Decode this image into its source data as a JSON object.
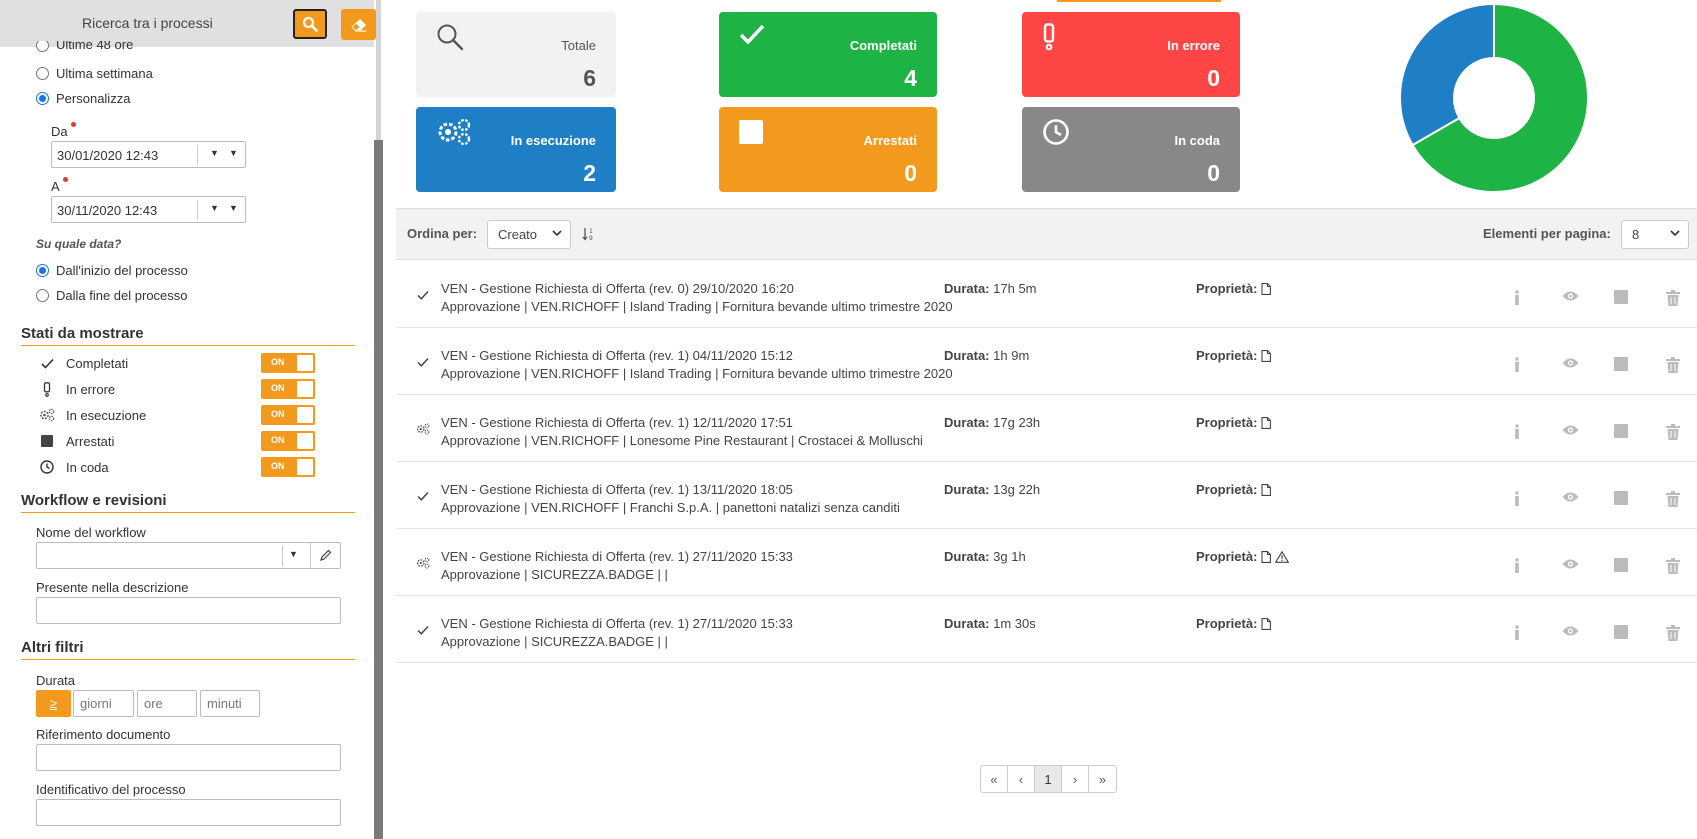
{
  "sidebar": {
    "title": "Ricerca tra i processi",
    "period_options": [
      "Ultime 48 ore",
      "Ultima settimana",
      "Personalizza"
    ],
    "from_label": "Da",
    "from_value": "30/01/2020 12:43",
    "to_label": "A",
    "to_value": "30/11/2020 12:43",
    "which_date_label": "Su quale data?",
    "date_options": [
      "Dall'inizio del processo",
      "Dalla fine del processo"
    ],
    "states_title": "Stati da mostrare",
    "states": [
      "Completati",
      "In errore",
      "In esecuzione",
      "Arrestati",
      "In coda"
    ],
    "toggle_label": "ON",
    "workflow_title": "Workflow e revisioni",
    "workflow_name_label": "Nome del workflow",
    "description_label": "Presente nella descrizione",
    "other_title": "Altri filtri",
    "duration_label": "Durata",
    "duration_op": "≥",
    "duration_days": "giorni",
    "duration_hours": "ore",
    "duration_minutes": "minuti",
    "docref_label": "Riferimento documento",
    "procid_label": "Identificativo del processo"
  },
  "cards": [
    {
      "label": "Totale",
      "value": "6",
      "color": "#f2f2f2",
      "icon": "search-icon"
    },
    {
      "label": "Completati",
      "value": "4",
      "color": "#1db445",
      "icon": "check-icon"
    },
    {
      "label": "In errore",
      "value": "0",
      "color": "#ff4646",
      "icon": "exclamation-icon"
    },
    {
      "label": "In esecuzione",
      "value": "2",
      "color": "#1e7fc6",
      "icon": "gears-icon"
    },
    {
      "label": "Arrestati",
      "value": "0",
      "color": "#f39a1e",
      "icon": "stop-icon"
    },
    {
      "label": "In coda",
      "value": "0",
      "color": "#888888",
      "icon": "clock-icon"
    }
  ],
  "chart_data": {
    "type": "pie",
    "categories": [
      "Completati",
      "In esecuzione"
    ],
    "values": [
      4,
      2
    ],
    "colors": [
      "#1db445",
      "#1e7fc6"
    ],
    "donut": true
  },
  "toolbar": {
    "sort_label": "Ordina per:",
    "sort_value": "Creato",
    "per_page_label": "Elementi per pagina:",
    "per_page_value": "8"
  },
  "rows": [
    {
      "status": "check-icon",
      "title": "VEN - Gestione Richiesta di Offerta (rev. 0) 29/10/2020 16:20",
      "desc": "Approvazione | VEN.RICHOFF | Island Trading | Fornitura bevande ultimo trimestre 2020",
      "duration_label": "Durata:",
      "duration": "17h 5m",
      "props_label": "Proprietà:",
      "warning": false
    },
    {
      "status": "check-icon",
      "title": "VEN - Gestione Richiesta di Offerta (rev. 1) 04/11/2020 15:12",
      "desc": "Approvazione | VEN.RICHOFF | Island Trading | Fornitura bevande ultimo trimestre 2020",
      "duration_label": "Durata:",
      "duration": "1h 9m",
      "props_label": "Proprietà:",
      "warning": false
    },
    {
      "status": "gears-icon",
      "title": "VEN - Gestione Richiesta di Offerta (rev. 1) 12/11/2020 17:51",
      "desc": "Approvazione | VEN.RICHOFF | Lonesome Pine Restaurant | Crostacei & Molluschi",
      "duration_label": "Durata:",
      "duration": "17g 23h",
      "props_label": "Proprietà:",
      "warning": false
    },
    {
      "status": "check-icon",
      "title": "VEN - Gestione Richiesta di Offerta (rev. 1) 13/11/2020 18:05",
      "desc": "Approvazione | VEN.RICHOFF | Franchi S.p.A. | panettoni natalizi senza canditi",
      "duration_label": "Durata:",
      "duration": "13g 22h",
      "props_label": "Proprietà:",
      "warning": false
    },
    {
      "status": "gears-icon",
      "title": "VEN - Gestione Richiesta di Offerta (rev. 1) 27/11/2020 15:33",
      "desc": "Approvazione | SICUREZZA.BADGE | |",
      "duration_label": "Durata:",
      "duration": "3g 1h",
      "props_label": "Proprietà:",
      "warning": true
    },
    {
      "status": "check-icon",
      "title": "VEN - Gestione Richiesta di Offerta (rev. 1) 27/11/2020 15:33",
      "desc": "Approvazione | SICUREZZA.BADGE | |",
      "duration_label": "Durata:",
      "duration": "1m 30s",
      "props_label": "Proprietà:",
      "warning": false
    }
  ],
  "pager": {
    "first": "«",
    "prev": "‹",
    "current": "1",
    "next": "›",
    "last": "»"
  }
}
